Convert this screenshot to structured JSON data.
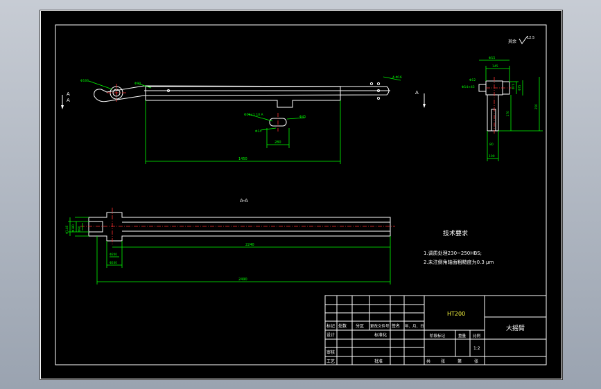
{
  "drawing": {
    "section_mark": "A",
    "section_view_label": "A-A",
    "surface_finish": "其余",
    "surface_value": "12.5",
    "front_dims": {
      "overall_width": "1450",
      "slot_width": "280",
      "hole_note": "4-Φ16",
      "slot_note": "Φ50×1 10 A",
      "slot_depth": "Φ45",
      "hole_dia": "Φ14",
      "boss_dia": "Φ166",
      "bar_dim": "Φ90"
    },
    "side_dims": {
      "top_width": "Φ15",
      "flange_width": "145",
      "left_dim": "Φ12",
      "hole_dim": "Φ14×45",
      "inner_dia": "Φ70",
      "outer_dia": "Φ75",
      "height_total": "250",
      "height_mid": "170",
      "web_width": "80",
      "base_width": "100"
    },
    "section_dims": {
      "length_inner": "2240",
      "length_total": "2490",
      "d1": "Φ1.46",
      "d2": "Φ180",
      "d3": "Φ90",
      "d4": "Φ200",
      "d5": "Φ240"
    }
  },
  "notes": {
    "title": "技术要求",
    "items": [
      "1.调质处理230~250HBS;",
      "2.未注倒角轴面粗糙度为0.3 μm"
    ]
  },
  "title_block": {
    "material": "HT200",
    "part_name": "大摇臂",
    "rev_headers": [
      "标记",
      "处数",
      "分区",
      "更改文件号",
      "签名",
      "年、月、日"
    ],
    "role_design": "设计",
    "role_standard": "标准化",
    "role_review": "审核",
    "role_process": "工艺",
    "role_approve": "批准",
    "stage_mark": "阶段标记",
    "weight": "重量",
    "scale_label": "比例",
    "scale_value": "1:2",
    "sheet_total": "共",
    "sheet_count": "张",
    "sheet_no": "第",
    "sheet_unit": "张"
  },
  "colors": {
    "background": "#000000",
    "geometry": "#ffffff",
    "dimension": "#00ff00",
    "centerline": "#ff3030",
    "material_text": "#ffff40"
  }
}
